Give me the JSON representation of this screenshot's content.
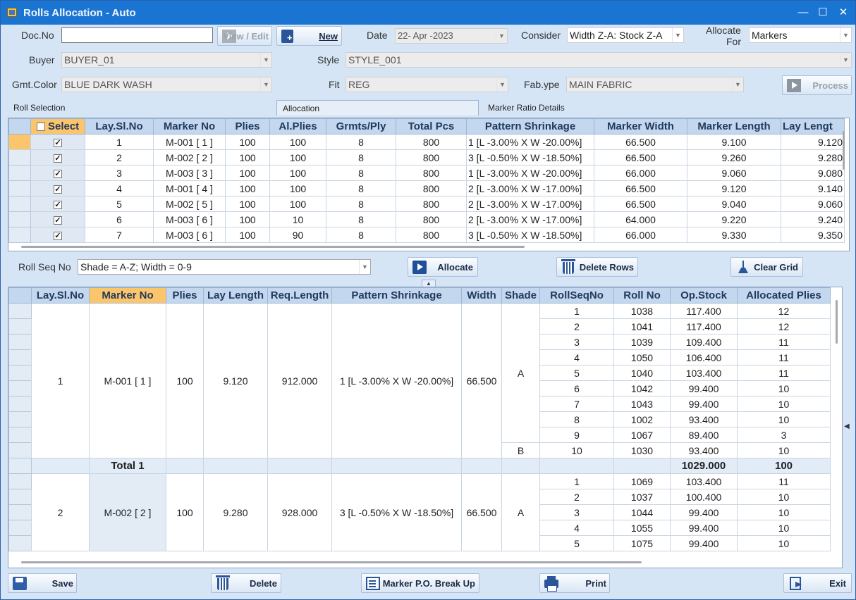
{
  "window": {
    "title": "Rolls Allocation - Auto",
    "minimize": "—",
    "maximize": "☐",
    "close": "✕"
  },
  "form": {
    "docno_label": "Doc.No",
    "docno_value": "",
    "view_edit": "View / Edit",
    "new_label": "New",
    "date_label": "Date",
    "date_value": "22- Apr -2023",
    "consider_label": "Consider",
    "consider_value": "Width Z-A: Stock Z-A",
    "allocate_for_label_1": "Allocate",
    "allocate_for_label_2": "For",
    "allocate_for_value": "Markers",
    "buyer_label": "Buyer",
    "buyer_value": "BUYER_01",
    "style_label": "Style",
    "style_value": "STYLE_001",
    "gmtcolor_label": "Gmt.Color",
    "gmtcolor_value": "BLUE DARK WASH",
    "fit_label": "Fit",
    "fit_value": "REG",
    "fabtype_label": "Fab.ype",
    "fabtype_value": "MAIN FABRIC",
    "process": "Process"
  },
  "tabs": [
    "Roll Selection",
    "Allocation",
    "Marker Ratio Details"
  ],
  "top_grid": {
    "headers": [
      "Select",
      "Lay.Sl.No",
      "Marker No",
      "Plies",
      "Al.Plies",
      "Grmts/Ply",
      "Total Pcs",
      "Pattern Shrinkage",
      "Marker Width",
      "Marker Length",
      "Lay Lengt"
    ],
    "rows": [
      [
        "1",
        "M-001 [ 1 ]",
        "100",
        "100",
        "8",
        "800",
        "1 [L -3.00% X W -20.00%]",
        "66.500",
        "9.100",
        "9.120"
      ],
      [
        "2",
        "M-002 [ 2 ]",
        "100",
        "100",
        "8",
        "800",
        "3 [L -0.50% X W -18.50%]",
        "66.500",
        "9.260",
        "9.280"
      ],
      [
        "3",
        "M-003 [ 3 ]",
        "100",
        "100",
        "8",
        "800",
        "1 [L -3.00% X W -20.00%]",
        "66.000",
        "9.060",
        "9.080"
      ],
      [
        "4",
        "M-001 [ 4 ]",
        "100",
        "100",
        "8",
        "800",
        "2 [L -3.00% X W -17.00%]",
        "66.500",
        "9.120",
        "9.140"
      ],
      [
        "5",
        "M-002 [ 5 ]",
        "100",
        "100",
        "8",
        "800",
        "2 [L -3.00% X W -17.00%]",
        "66.500",
        "9.040",
        "9.060"
      ],
      [
        "6",
        "M-003 [ 6 ]",
        "100",
        "10",
        "8",
        "800",
        "2 [L -3.00% X W -17.00%]",
        "64.000",
        "9.220",
        "9.240"
      ],
      [
        "7",
        "M-003 [ 6 ]",
        "100",
        "90",
        "8",
        "800",
        "3 [L -0.50% X W -18.50%]",
        "66.000",
        "9.330",
        "9.350"
      ]
    ]
  },
  "mid": {
    "rollseq_label": "Roll Seq No",
    "rollseq_value": "Shade = A-Z; Width = 0-9",
    "allocate": "Allocate",
    "delete_rows": "Delete Rows",
    "clear_grid": "Clear Grid"
  },
  "bottom_grid": {
    "headers": [
      "Lay.Sl.No",
      "Marker No",
      "Plies",
      "Lay Length",
      "Req.Length",
      "Pattern Shrinkage",
      "Width",
      "Shade",
      "RollSeqNo",
      "Roll No",
      "Op.Stock",
      "Allocated Plies"
    ],
    "group1": {
      "lay": "1",
      "marker": "M-001 [ 1 ]",
      "plies": "100",
      "lay_length": "9.120",
      "req_length": "912.000",
      "shrink": "1 [L -3.00% X W -20.00%]",
      "width": "66.500",
      "shade_a": "A",
      "shade_b": "B",
      "rolls": [
        [
          "1",
          "1038",
          "117.400",
          "12"
        ],
        [
          "2",
          "1041",
          "117.400",
          "12"
        ],
        [
          "3",
          "1039",
          "109.400",
          "11"
        ],
        [
          "4",
          "1050",
          "106.400",
          "11"
        ],
        [
          "5",
          "1040",
          "103.400",
          "11"
        ],
        [
          "6",
          "1042",
          "99.400",
          "10"
        ],
        [
          "7",
          "1043",
          "99.400",
          "10"
        ],
        [
          "8",
          "1002",
          "93.400",
          "10"
        ],
        [
          "9",
          "1067",
          "89.400",
          "3"
        ],
        [
          "10",
          "1030",
          "93.400",
          "10"
        ]
      ],
      "total_label": "Total 1",
      "total_stock": "1029.000",
      "total_plies": "100"
    },
    "group2": {
      "lay": "2",
      "marker": "M-002 [ 2 ]",
      "plies": "100",
      "lay_length": "9.280",
      "req_length": "928.000",
      "shrink": "3 [L -0.50% X W -18.50%]",
      "width": "66.500",
      "shade_a": "A",
      "rolls": [
        [
          "1",
          "1069",
          "103.400",
          "11"
        ],
        [
          "2",
          "1037",
          "100.400",
          "10"
        ],
        [
          "3",
          "1044",
          "99.400",
          "10"
        ],
        [
          "4",
          "1055",
          "99.400",
          "10"
        ],
        [
          "5",
          "1075",
          "99.400",
          "10"
        ]
      ]
    }
  },
  "footer": {
    "save": "Save",
    "delete": "Delete",
    "marker_po": "Marker P.O. Break Up",
    "print": "Print",
    "exit": "Exit"
  }
}
